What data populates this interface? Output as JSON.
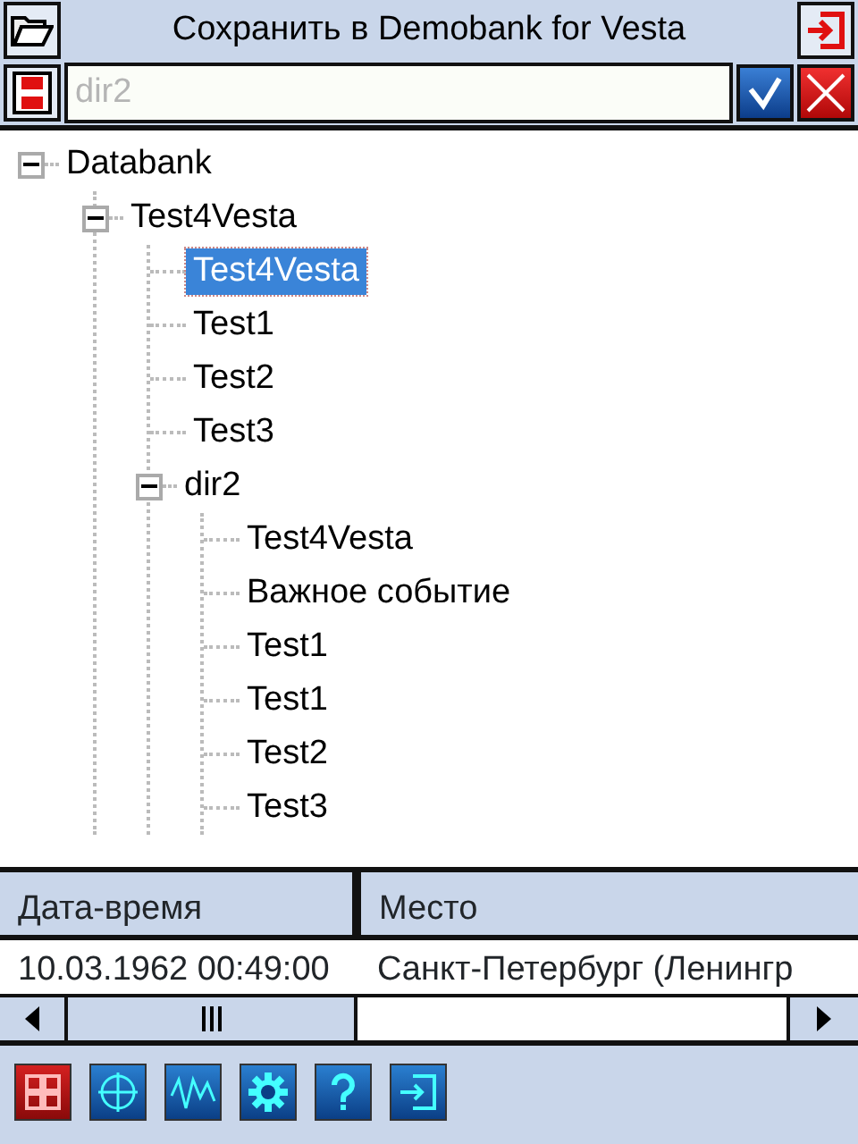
{
  "window": {
    "title": "Сохранить в Demobank for Vesta"
  },
  "name_field": {
    "placeholder": "dir2"
  },
  "tree": [
    {
      "label": "Databank",
      "expanded": true,
      "children": [
        {
          "label": "Test4Vesta",
          "expanded": true,
          "children": [
            {
              "label": "Test4Vesta",
              "selected": true
            },
            {
              "label": "Test1",
              "selected": false
            },
            {
              "label": "Test2",
              "selected": false
            },
            {
              "label": "Test3",
              "selected": false
            },
            {
              "label": "dir2",
              "expanded": true,
              "children": [
                {
                  "label": "Test4Vesta",
                  "selected": false
                },
                {
                  "label": "Важное событие",
                  "selected": false
                },
                {
                  "label": "Test1",
                  "selected": false
                },
                {
                  "label": "Test1",
                  "selected": false
                },
                {
                  "label": "Test2",
                  "selected": false
                },
                {
                  "label": "Test3",
                  "selected": false
                }
              ]
            }
          ]
        }
      ]
    }
  ],
  "table": {
    "columns": [
      "Дата-время",
      "Место"
    ],
    "rows": [
      [
        "10.03.1962 00:49:00",
        "Санкт-Петербург (Ленингр"
      ]
    ]
  }
}
